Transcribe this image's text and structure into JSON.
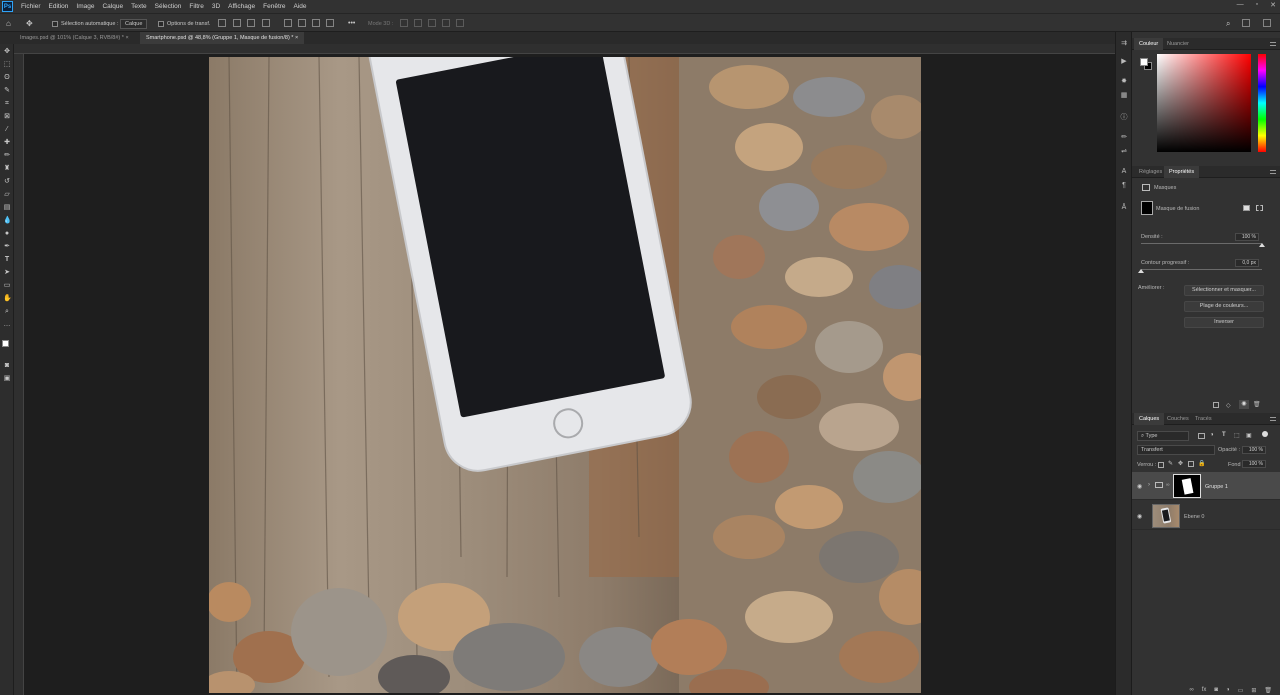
{
  "app": {
    "logo": "Ps"
  },
  "menubar": [
    "Fichier",
    "Edition",
    "Image",
    "Calque",
    "Texte",
    "Sélection",
    "Filtre",
    "3D",
    "Affichage",
    "Fenêtre",
    "Aide"
  ],
  "options": {
    "auto_select_label": "Sélection automatique :",
    "auto_select_value": "Calque",
    "transform_label": "Options de transf.",
    "more": "•••",
    "mode_3d": "Mode 3D :"
  },
  "tabs": [
    {
      "label": "Images.psd @ 101% (Calque 3, RVB/8#) *",
      "active": false
    },
    {
      "label": "Smartphone.psd @ 48,8% (Gruppe 1, Masque de fusion/8) *",
      "active": true
    }
  ],
  "color_panel": {
    "tabs": [
      "Couleur",
      "Nuancier"
    ],
    "fg": "#ffffff",
    "bg": "#000000",
    "hue_color": "#ff0000"
  },
  "properties_panel": {
    "tabs": [
      "Réglages",
      "Propriétés"
    ],
    "section": "Masques",
    "mask_label": "Masque de fusion",
    "density_label": "Densité :",
    "density_value": "100 %",
    "density": 1.0,
    "feather_label": "Contour progressif :",
    "feather_value": "0,0 px",
    "feather": 0.0,
    "refine_label": "Améliorer :",
    "buttons": [
      "Sélectionner et masquer...",
      "Plage de couleurs...",
      "Inverser"
    ]
  },
  "layers_panel": {
    "tabs": [
      "Calques",
      "Couches",
      "Tracés"
    ],
    "filter": "Type",
    "blend_mode": "Transfert",
    "opacity_label": "Opacité :",
    "opacity_value": "100 %",
    "lock_label": "Verrou :",
    "fill_label": "Fond :",
    "fill_value": "100 %",
    "layers": [
      {
        "name": "Gruppe 1",
        "selected": true
      },
      {
        "name": "Ebene 0",
        "selected": false
      }
    ]
  }
}
